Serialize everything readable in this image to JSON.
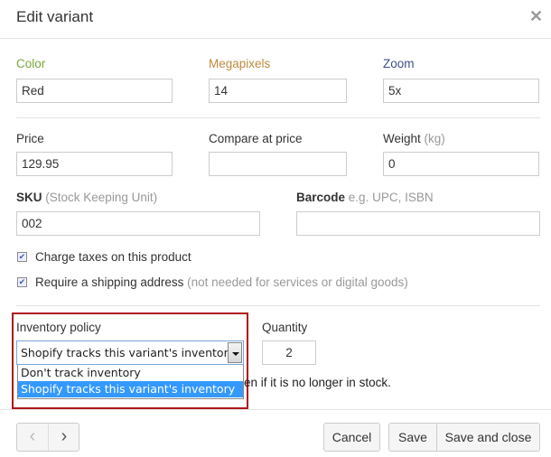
{
  "dialog": {
    "title": "Edit variant",
    "close_icon": "close-icon"
  },
  "options": [
    {
      "label": "Color",
      "value": "Red",
      "color": "#7aa83a"
    },
    {
      "label": "Megapixels",
      "value": "14",
      "color": "#c08a3e"
    },
    {
      "label": "Zoom",
      "value": "5x",
      "color": "#3d4f8a"
    }
  ],
  "pricing": {
    "price_label": "Price",
    "price_value": "129.95",
    "compare_label": "Compare at price",
    "compare_value": "",
    "weight_label": "Weight",
    "weight_unit": "(kg)",
    "weight_value": "0"
  },
  "identifiers": {
    "sku_label": "SKU",
    "sku_hint": "(Stock Keeping Unit)",
    "sku_value": "002",
    "barcode_label": "Barcode",
    "barcode_hint": "e.g. UPC, ISBN",
    "barcode_value": ""
  },
  "checkboxes": [
    {
      "label": "Charge taxes on this product",
      "hint": "",
      "checked": true
    },
    {
      "label": "Require a shipping address",
      "hint": "(not needed for services or digital goods)",
      "checked": true
    }
  ],
  "inventory": {
    "policy_label": "Inventory policy",
    "selected": "Shopify tracks this variant's inventory",
    "dropdown_options": [
      "Don't track inventory",
      "Shopify tracks this variant's inventory"
    ],
    "quantity_label": "Quantity",
    "quantity_value": "2",
    "note_visible": "en if it is no longer in stock."
  },
  "footer": {
    "prev_icon": "chevron-left-icon",
    "next_icon": "chevron-right-icon",
    "cancel_label": "Cancel",
    "save_label": "Save",
    "save_close_label": "Save and close"
  }
}
